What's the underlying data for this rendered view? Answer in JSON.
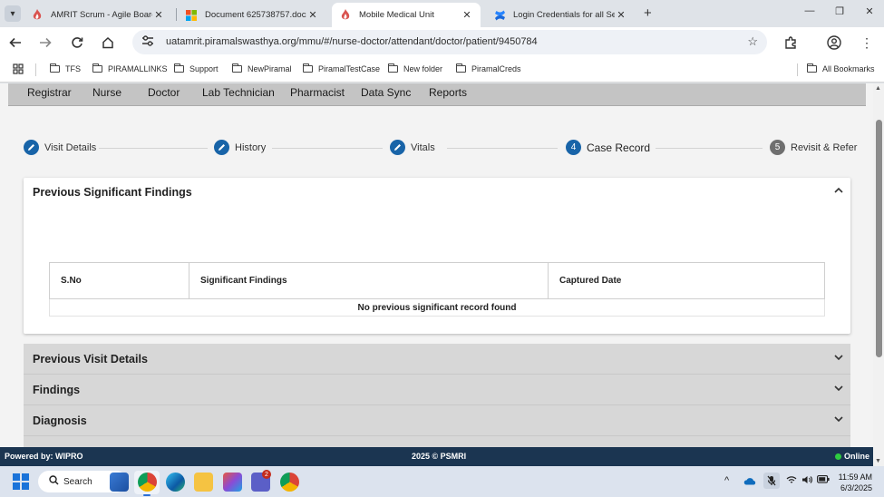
{
  "browser": {
    "tabs": [
      {
        "title": "AMRIT Scrum - Agile Board",
        "icon": "amrit-flame-icon",
        "active": false
      },
      {
        "title": "Document 625738757.docx",
        "icon": "microsoft-icon",
        "active": false
      },
      {
        "title": "Mobile Medical Unit",
        "icon": "amrit-flame-icon",
        "active": true
      },
      {
        "title": "Login Credentials for all Serv",
        "icon": "confluence-icon",
        "active": false
      }
    ],
    "url": "uatamrit.piramalswasthya.org/mmu/#/nurse-doctor/attendant/doctor/patient/9450784",
    "bookmarks": [
      "TFS",
      "PIRAMALLINKS",
      "Support",
      "NewPiramal",
      "PiramalTestCase",
      "New folder",
      "PiramalCreds"
    ],
    "all_bookmarks": "All Bookmarks"
  },
  "nav": {
    "roles": [
      "Registrar",
      "Nurse",
      "Doctor",
      "Lab Technician",
      "Pharmacist",
      "Data Sync",
      "Reports"
    ]
  },
  "stepper": {
    "steps": [
      {
        "label": "Visit Details",
        "state": "done",
        "marker": ""
      },
      {
        "label": "History",
        "state": "done",
        "marker": ""
      },
      {
        "label": "Vitals",
        "state": "done",
        "marker": ""
      },
      {
        "label": "Case Record",
        "state": "current",
        "marker": "4"
      },
      {
        "label": "Revisit & Refer",
        "state": "pending",
        "marker": "5"
      }
    ]
  },
  "findings_card": {
    "title": "Previous Significant Findings",
    "columns": [
      "S.No",
      "Significant Findings",
      "Captured Date"
    ],
    "empty_message": "No previous significant record found"
  },
  "panels": [
    {
      "title": "Previous Visit Details"
    },
    {
      "title": "Findings"
    },
    {
      "title": "Diagnosis"
    }
  ],
  "footer": {
    "powered_by": "Powered by: WIPRO",
    "copyright": "2025 © PSMRI",
    "status": "Online"
  },
  "taskbar": {
    "search_label": "Search",
    "teams_badge": "2",
    "time": "11:59 AM",
    "date": "6/3/2025"
  },
  "colors": {
    "primary": "#1864a8",
    "footer_bg": "#1b3551",
    "online": "#2ecc40"
  }
}
